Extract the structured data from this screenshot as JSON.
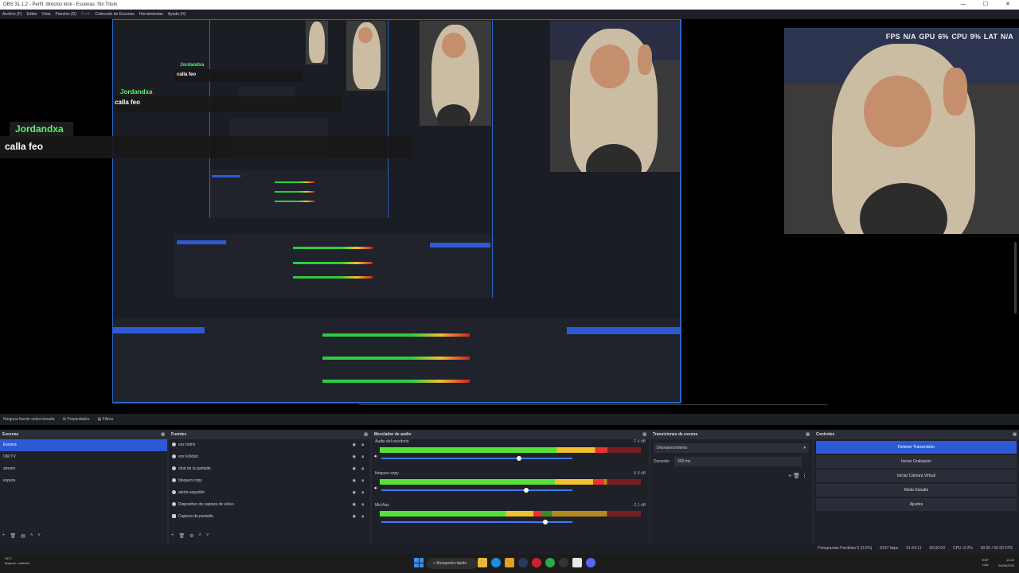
{
  "titlebar": {
    "title": "OBS 31.1.2 - Perfil: directos kick - Escenas: Sin Título",
    "controls": [
      "—",
      "☐",
      "✕"
    ]
  },
  "menu": [
    "Archivo (F)",
    "Editar",
    "Vista",
    "Paneles (D)",
    "Perfil",
    "Colección de Escenas",
    "Herramientas",
    "Ayuda (H)"
  ],
  "stats": {
    "fps_label": "FPS",
    "fps": "N/A",
    "gpu_label": "GPU",
    "gpu": "6%",
    "cpu_label": "CPU",
    "cpu": "9%",
    "lat_label": "LAT",
    "lat": "N/A"
  },
  "chat": [
    {
      "user": "Jordandxa",
      "msg": "calla feo"
    },
    {
      "user": "Jordandxa",
      "msg": "calla feo"
    },
    {
      "user": "Jordandxa",
      "msg": "calla feo"
    }
  ],
  "source_toolbar": {
    "no_source": "Ninguna fuente seleccionada",
    "properties": "Propiedades",
    "filters": "Filtros"
  },
  "scenes": {
    "title": "Escenas",
    "items": [
      "Escena",
      "OM TV",
      "stream",
      "espera"
    ],
    "selected": 0
  },
  "sources": {
    "title": "Fuentes",
    "items": [
      "voz botrix",
      "voz kickbot",
      "chat de la pantalla",
      "bloqueo copy",
      "alerta seguidor",
      "Dispositivo de captura de vídeo",
      "Captura de pantalla"
    ]
  },
  "mixer": {
    "title": "Mezclador de audio",
    "channels": [
      {
        "name": "Audio del escritorio",
        "db": "-7.4 dB",
        "level": 0.87,
        "fader": 0.72
      },
      {
        "name": "bloqueo copy",
        "db": "-5.9 dB",
        "level": 0.86,
        "fader": 0.76
      },
      {
        "name": "Mic/Aux",
        "db": "-2.1 dB",
        "level": 0.62,
        "fader": 0.86
      }
    ]
  },
  "transitions": {
    "title": "Transiciones de escena",
    "selected": "Desvanecimiento",
    "duration_label": "Duración",
    "duration": "300 ms"
  },
  "controls": {
    "title": "Controles",
    "buttons": [
      "Detener Transmisión",
      "Iniciar Grabación",
      "Iniciar Cámara Virtual",
      "Modo Estudio",
      "Ajustes"
    ]
  },
  "statusbar": {
    "dropped": "Fotogramas Perdidos 0 (0.0%)",
    "kbps": "8157 kbps",
    "time": "01:54:11",
    "rec": "00:00:00",
    "cpu": "CPU: 8.2%",
    "fps": "60.00 / 60.00 FPS"
  },
  "taskbar": {
    "temp": "16°C",
    "weather": "Mayorm. nublado",
    "search": "Búsqueda rápida",
    "lang1": "ESP",
    "lang2": "LAA",
    "time": "12:22",
    "date": "24/06/2025"
  },
  "colors": {
    "accent": "#2c5ad6",
    "chat_user": "#5cf06a",
    "meter_green": "#58e03a",
    "meter_yellow": "#f0c030",
    "meter_red": "#f03030"
  }
}
